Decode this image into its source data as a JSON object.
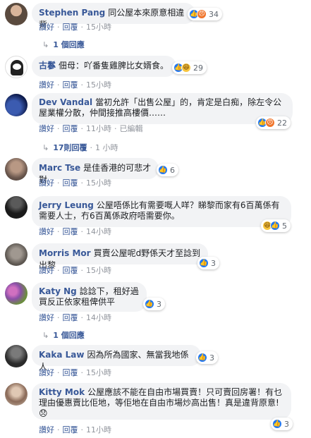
{
  "actions": {
    "like": "讚好",
    "reply": "回覆",
    "sep": "·",
    "edited": "已編輯"
  },
  "comments": [
    {
      "author": "Stephen Pang",
      "text": "同公屋本來原意相違背",
      "react_count": "34",
      "time": "15小時",
      "replies": "1 個回應"
    },
    {
      "author": "古鬖",
      "text": "佃母：吖番隻雞脾比女婿食。",
      "react_count": "29",
      "time": "15小時"
    },
    {
      "author": "Dev Vandal",
      "text": "當初允許「出售公屋」的，肯定是白痴，除左令公屋業權分散，仲間接推高樓價……",
      "react_count": "22",
      "time": "11小時",
      "replies": "17則回覆",
      "replies_time": "1 小時"
    },
    {
      "author": "Marc Tse",
      "text": "是佳香港的可悲才對",
      "react_count": "6",
      "time": "15小時"
    },
    {
      "author": "Jerry Leung",
      "text": "公屋唔係比有需要嘅人咩？睇黎而家有6百萬係有需要人士，冇6百萬係政府唔需要你。",
      "react_count": "5",
      "time": "14小時"
    },
    {
      "author": "Morris Mor",
      "text": "買賣公屋呢d野係天才至諗到出黎",
      "react_count": "3",
      "time": "15小時"
    },
    {
      "author": "Katy Ng",
      "text": "諗諗下，租好過買反正依家租俾供平",
      "react_count": "3",
      "time": "14小時",
      "replies": "1 個回應"
    },
    {
      "author": "Kaka Law",
      "text": "因為所為國家、無當我地係人",
      "react_count": "3",
      "time": "15小時"
    },
    {
      "author": "Kitty Mok",
      "text": "公屋應該不能在自由市場買賣！只可賣回房署！有乜理由優惠賣比佢地，等佢地在自由市場炒高出售！真是違背原意!😞",
      "react_count": "3",
      "time": "11小時"
    }
  ],
  "colors": {
    "link": "#385898",
    "bubble": "#f2f3f5",
    "meta": "#90949c",
    "like": "#2078f4"
  }
}
